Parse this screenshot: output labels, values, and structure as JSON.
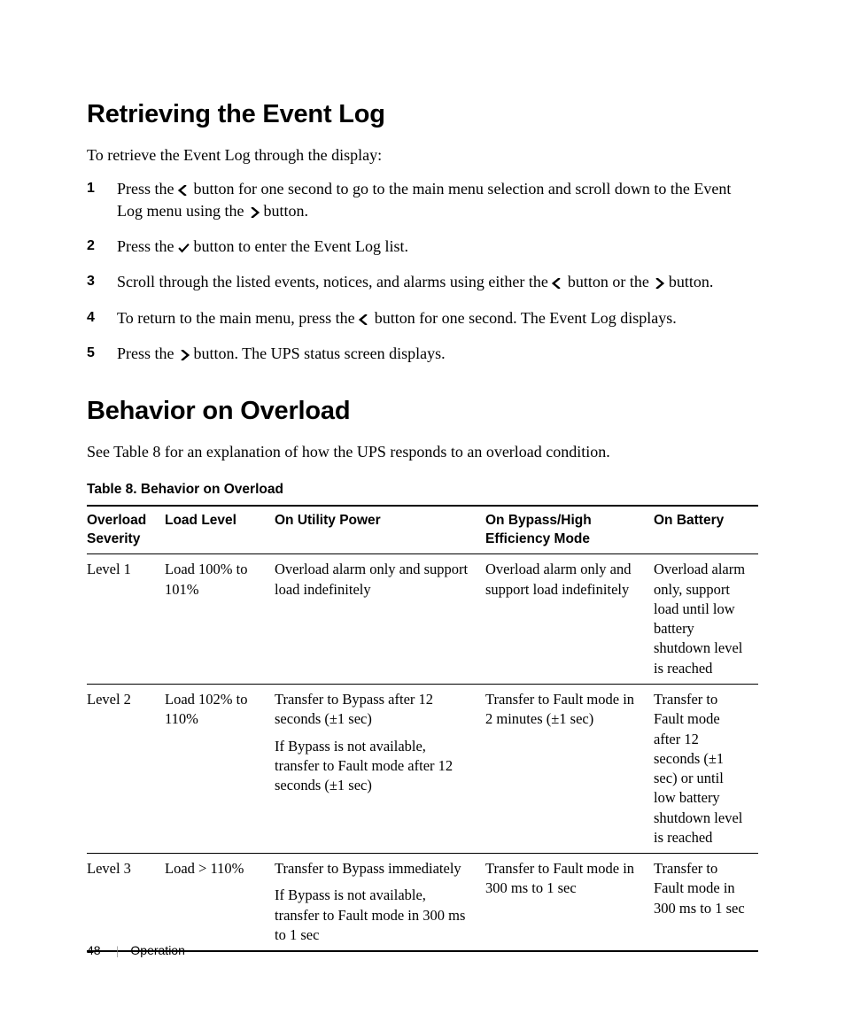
{
  "section1": {
    "title": "Retrieving the Event Log",
    "intro": "To retrieve the Event Log through the display:",
    "steps": [
      {
        "num": "1",
        "pre": "Press the ",
        "icon": "left",
        "post": " button for one second to go to the main menu selection and scroll down to the Event Log menu using the ",
        "icon2": "right",
        "post2": " button."
      },
      {
        "num": "2",
        "pre": "Press the ",
        "icon": "check",
        "post": " button to enter the Event Log list."
      },
      {
        "num": "3",
        "pre": "Scroll through the listed events, notices, and alarms using either the ",
        "icon": "left",
        "post": " button or the ",
        "icon2": "right",
        "post2": " button."
      },
      {
        "num": "4",
        "pre": "To return to the main menu, press the ",
        "icon": "left",
        "post": " button for one second. The Event Log displays."
      },
      {
        "num": "5",
        "pre": "Press the ",
        "icon": "right",
        "post": " button. The UPS status screen displays."
      }
    ]
  },
  "section2": {
    "title": "Behavior on Overload",
    "intro": "See Table 8 for an explanation of how the UPS responds to an overload condition."
  },
  "table": {
    "caption": "Table 8. Behavior on Overload",
    "headers": {
      "severity": "Overload Severity",
      "load": "Load Level",
      "utility": "On Utility Power",
      "bypass": "On Bypass/High Efficiency Mode",
      "battery": "On Battery"
    },
    "rows": [
      {
        "severity": "Level 1",
        "load": "Load 100% to 101%",
        "utility": [
          "Overload alarm only and support load indefinitely"
        ],
        "bypass": "Overload alarm only and support load indefinitely",
        "battery": "Overload alarm only, support load until low battery shutdown level is reached"
      },
      {
        "severity": "Level 2",
        "load": "Load 102% to 110%",
        "utility": [
          "Transfer to Bypass after 12 seconds (±1 sec)",
          "If Bypass is not available, transfer to Fault mode after 12 seconds (±1 sec)"
        ],
        "bypass": "Transfer to Fault mode in 2 minutes (±1 sec)",
        "battery": "Transfer to Fault mode after 12 seconds (±1 sec) or until low battery shutdown level is reached"
      },
      {
        "severity": "Level 3",
        "load": "Load > 110%",
        "utility": [
          "Transfer to Bypass immediately",
          "If Bypass is not available, transfer to Fault mode in 300 ms to 1 sec"
        ],
        "bypass": "Transfer to Fault mode in 300 ms to 1 sec",
        "battery": "Transfer to Fault mode in 300 ms to 1 sec"
      }
    ]
  },
  "footer": {
    "page": "48",
    "chapter": "Operation"
  },
  "icons": {
    "left": "left",
    "right": "right",
    "check": "check"
  }
}
